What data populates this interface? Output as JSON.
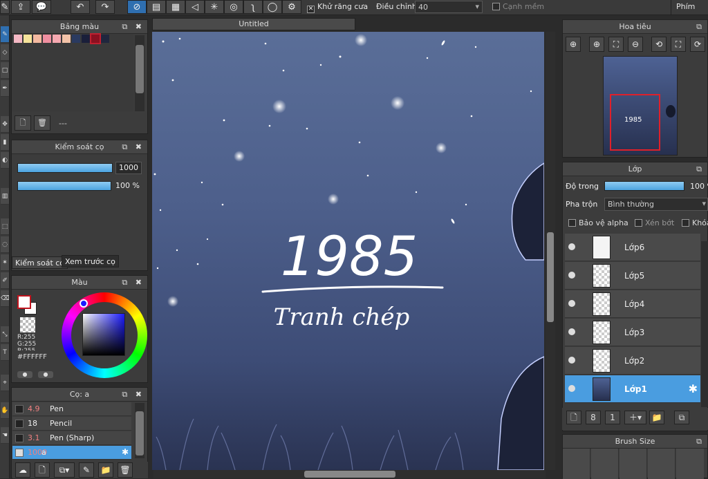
{
  "toolbar": {
    "antialias_label": "Khử răng cưa",
    "adjust_label": "Điều chỉnh",
    "adjust_value": "40",
    "soft_edge_label": "Cạnh mềm",
    "keys_label": "Phím"
  },
  "palette": {
    "title": "Bảng màu",
    "footer_label": "---",
    "swatches": [
      "#f4b8c4",
      "#f6e39a",
      "#f4b9a0",
      "#f08fa0",
      "#f6a8b0",
      "#f3c2a8",
      "#2a3a60",
      "#1a1f3a",
      "#8b1020",
      "#20263e"
    ]
  },
  "brush_control": {
    "title": "Kiểm soát cọ",
    "size_value": "1000",
    "opacity_value": "100 %",
    "tab_control": "Kiểm soát cọ",
    "tab_preview": "Xem trước cọ"
  },
  "color": {
    "title": "Màu",
    "r": "R:255",
    "g": "G:255",
    "b": "B:255",
    "hex": "#FFFFFF"
  },
  "brushes": {
    "title": "Cọ: a",
    "items": [
      {
        "size": "4.9",
        "name": "Pen",
        "size_color": "#f08080"
      },
      {
        "size": "18",
        "name": "Pencil",
        "size_color": "#eeeeee"
      },
      {
        "size": "3.1",
        "name": "Pen (Sharp)",
        "size_color": "#f08080"
      },
      {
        "size": "1000",
        "name": "a",
        "size_color": "#f08080"
      }
    ]
  },
  "canvas": {
    "tab_title": "Untitled",
    "art_title": "1985",
    "art_subtitle": "Tranh chép"
  },
  "navigator": {
    "title": "Hoa tiêu"
  },
  "layers": {
    "title": "Lớp",
    "opacity_label": "Độ trong",
    "opacity_value": "100 %",
    "blend_label": "Pha trộn",
    "blend_value": "Bình thường",
    "protect_alpha": "Bảo vệ alpha",
    "clipping": "Xén bớt",
    "lock": "Khóa",
    "items": [
      "Lớp6",
      "Lớp5",
      "Lớp4",
      "Lớp3",
      "Lớp2",
      "Lớp1"
    ]
  },
  "brush_size_panel": {
    "title": "Brush Size"
  },
  "colors": {
    "accent": "#4a9de0",
    "panel": "#3c3c3c",
    "canvas_top": "#5a6e98",
    "canvas_bottom": "#2a3352"
  }
}
